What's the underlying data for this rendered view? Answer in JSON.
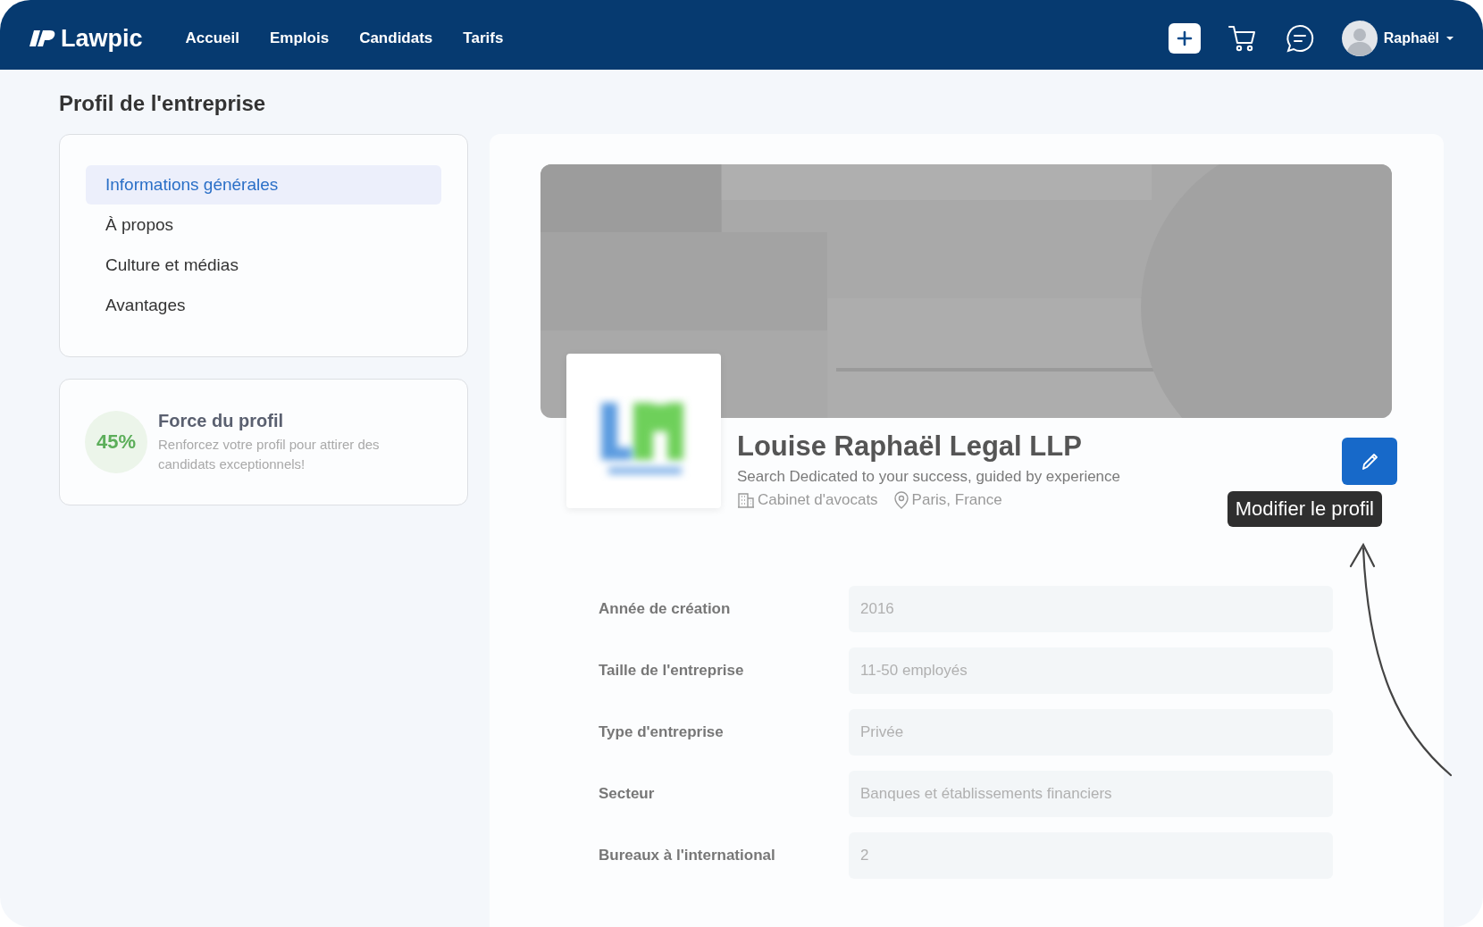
{
  "nav": {
    "logo": "Lawpic",
    "links": [
      "Accueil",
      "Emplois",
      "Candidats",
      "Tarifs"
    ],
    "user": "Raphaël"
  },
  "page_title": "Profil de l'entreprise",
  "sidebar": {
    "items": [
      {
        "label": "Informations générales",
        "selected": true
      },
      {
        "label": "À propos",
        "selected": false
      },
      {
        "label": "Culture et médias",
        "selected": false
      },
      {
        "label": "Avantages",
        "selected": false
      }
    ]
  },
  "profile_strength": {
    "percent": "45%",
    "title": "Force du profil",
    "text": "Renforcez votre profil pour attirer des candidats exceptionnels!"
  },
  "company": {
    "name": "Louise Raphaël Legal LLP",
    "tagline": "Search Dedicated to your success, guided by experience",
    "type": "Cabinet d'avocats",
    "location": "Paris, France"
  },
  "edit_tooltip": "Modifier le profil",
  "fields": [
    {
      "label": "Année de création",
      "value": "2016"
    },
    {
      "label": "Taille de l'entreprise",
      "value": "11-50 employés"
    },
    {
      "label": "Type d'entreprise",
      "value": "Privée"
    },
    {
      "label": "Secteur",
      "value": "Banques et établissements financiers"
    },
    {
      "label": "Bureaux à l'international",
      "value": "2"
    }
  ]
}
